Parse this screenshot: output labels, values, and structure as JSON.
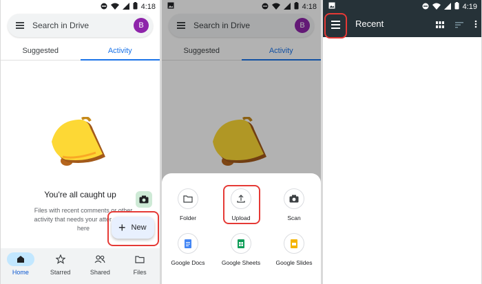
{
  "status": {
    "time_left": "4:18",
    "time_middle": "4:18",
    "time_right": "4:19"
  },
  "drive": {
    "search_placeholder": "Search in Drive",
    "avatar_letter": "B",
    "tabs": [
      "Suggested",
      "Activity"
    ],
    "empty_title": "You're all caught up",
    "empty_desc": "Files with recent comments or other activity that needs your atter appear here",
    "new_label": "New",
    "nav": [
      "Home",
      "Starred",
      "Shared",
      "Files"
    ]
  },
  "sheet": {
    "actions": [
      "Folder",
      "Upload",
      "Scan",
      "Google Docs",
      "Google Sheets",
      "Google Slides"
    ]
  },
  "recent": {
    "title": "Recent"
  },
  "colors": {
    "accent": "#1a73e8",
    "avatar": "#8e24aa",
    "highlight": "#e53935",
    "appbar": "#263238"
  },
  "icons": [
    "menu-icon",
    "bell-icon",
    "camera-icon",
    "plus-icon",
    "home-icon",
    "star-icon",
    "people-icon",
    "folder-icon",
    "upload-icon",
    "docs-icon",
    "sheets-icon",
    "slides-icon",
    "grid-icon",
    "sort-icon",
    "more-icon"
  ]
}
